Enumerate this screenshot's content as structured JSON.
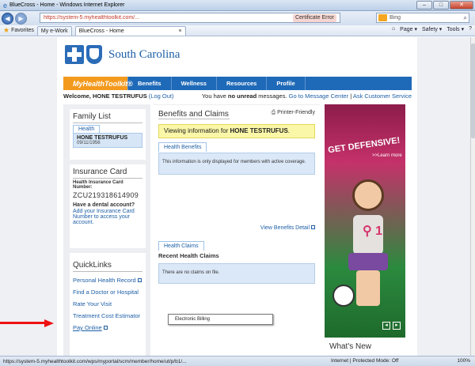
{
  "window": {
    "title": "BlueCross - Home - Windows Internet Explorer",
    "minimize": "–",
    "maximize": "□",
    "close": "✕"
  },
  "address_bar": {
    "url": "https://system-5.myhealthtoolkit.com/...",
    "cert_error": "Certificate Error",
    "search_placeholder": "Bing"
  },
  "favorites_bar": {
    "favorites": "Favorites",
    "my_ework": "My e-Work",
    "tab_title": "BlueCross - Home",
    "page": "Page ▾",
    "safety": "Safety ▾",
    "tools": "Tools ▾"
  },
  "site": {
    "brand": "South Carolina",
    "nav": [
      "MyHealthToolkit®",
      "Benefits",
      "Wellness",
      "Resources",
      "Profile"
    ],
    "welcome_prefix": "Welcome, HONE TESTRUFUS ",
    "logout": "(Log Out)",
    "messages_prefix": "You have ",
    "messages_bold": "no unread",
    "messages_suffix": " messages.",
    "message_center": "Go to Message Center",
    "separator": " | ",
    "ask_cs": "Ask Customer Service"
  },
  "family_list": {
    "title": "Family List",
    "tab": "Health",
    "member_name": "HONE TESTRUFUS",
    "member_dob": "09/11/1956"
  },
  "insurance_card": {
    "title": "Insurance Card",
    "label": "Health Insurance Card Number:",
    "number": "ZCU219318614909",
    "dental_q": "Have a dental account?",
    "dental_link": "Add your Insurance Card Number to access your account."
  },
  "quick_links": {
    "title": "QuickLinks",
    "items": [
      "Personal Health Record",
      "Find a Doctor or Hospital",
      "Rate Your Visit",
      "Treatment Cost Estimator",
      "Pay Online"
    ]
  },
  "benefits_claims": {
    "title": "Benefits and Claims",
    "printer": "Printer-Friendly",
    "viewing_prefix": "Viewing information for ",
    "viewing_name": "HONE TESTRUFUS",
    "viewing_suffix": ".",
    "health_benefits_tab": "Health Benefits",
    "benefits_info": "This information is only displayed for members with active coverage.",
    "view_detail": "View Benefits Detail",
    "health_claims_tab": "Health Claims",
    "recent_claims": "Recent Health Claims",
    "no_claims": "There are no claims on file."
  },
  "ad": {
    "headline": "GET DEFENSIVE!",
    "sub": ">>Learn more",
    "ribbon_number": "1",
    "prev": "◂",
    "next": "▸"
  },
  "whats_new": "What's New",
  "tooltip": "Electronic Billing",
  "status_bar": {
    "url": "https://system-5.myhealthtoolkit.com/wps/myportal/scm/member/home/ut/p/b1/...",
    "zone": "Internet | Protected Mode: Off",
    "zoom": "100%"
  }
}
